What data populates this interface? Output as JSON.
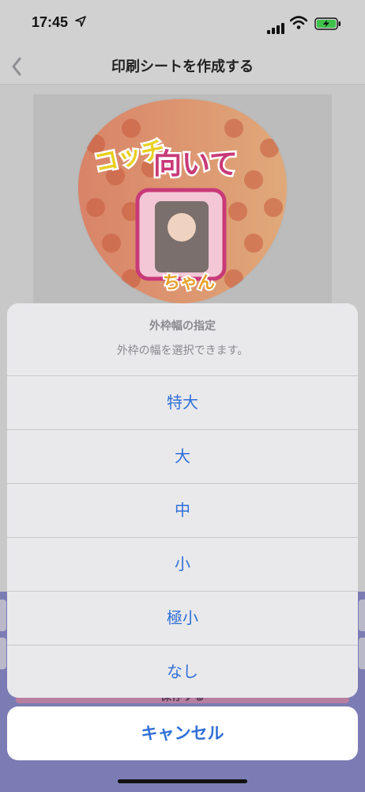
{
  "status": {
    "time": "17:45"
  },
  "nav": {
    "title": "印刷シートを作成する"
  },
  "preview": {
    "line1": "コッチ",
    "line2": "向いて",
    "line3": "ちゃん"
  },
  "background": {
    "save_label": "保存する"
  },
  "action_sheet": {
    "title": "外枠幅の指定",
    "message": "外枠の幅を選択できます。",
    "options": [
      "特大",
      "大",
      "中",
      "小",
      "極小",
      "なし"
    ],
    "cancel_label": "キャンセル"
  },
  "colors": {
    "accent": "#2f6fd6",
    "sheet_bg": "#e9e9ec",
    "purple": "#7b7cb4"
  }
}
